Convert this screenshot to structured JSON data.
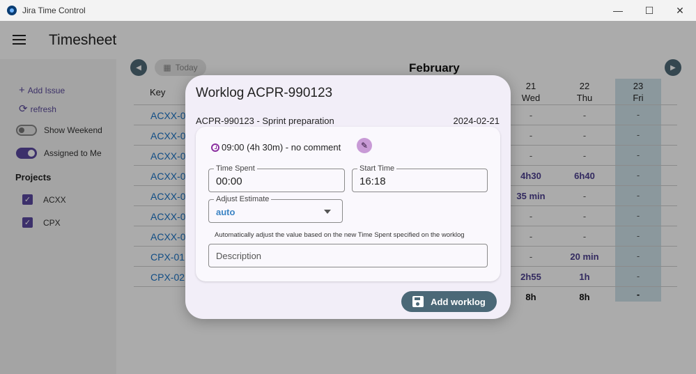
{
  "window": {
    "title": "Jira Time Control",
    "min": "—",
    "max": "☐",
    "close": "✕"
  },
  "appbar": {
    "title": "Timesheet"
  },
  "sidebar": {
    "add_issue": "Add Issue",
    "refresh": "refresh",
    "show_weekend": "Show Weekend",
    "assigned_to_me": "Assigned to Me",
    "projects_title": "Projects",
    "projects": [
      "ACXX",
      "CPX"
    ]
  },
  "main": {
    "today": "Today",
    "month": "February",
    "key_header": "Key",
    "days": [
      {
        "num": "21",
        "name": "Wed"
      },
      {
        "num": "22",
        "name": "Thu"
      },
      {
        "num": "23",
        "name": "Fri"
      }
    ],
    "rows": [
      {
        "key": "ACXX-0",
        "wed": "-",
        "thu": "-",
        "fri": "-"
      },
      {
        "key": "ACXX-0",
        "wed": "-",
        "thu": "-",
        "fri": "-"
      },
      {
        "key": "ACXX-0",
        "wed": "-",
        "thu": "-",
        "fri": "-"
      },
      {
        "key": "ACXX-0",
        "wed": "4h30",
        "thu": "6h40",
        "fri": "-"
      },
      {
        "key": "ACXX-0",
        "wed": "35 min",
        "thu": "-",
        "fri": "-"
      },
      {
        "key": "ACXX-0",
        "wed": "-",
        "thu": "-",
        "fri": "-"
      },
      {
        "key": "ACXX-0",
        "wed": "-",
        "thu": "-",
        "fri": "-"
      },
      {
        "key": "CPX-01",
        "wed": "-",
        "thu": "20 min",
        "fri": "-"
      },
      {
        "key": "CPX-02",
        "wed": "2h55",
        "thu": "1h",
        "fri": "-"
      }
    ],
    "totals": {
      "wed": "8h",
      "thu": "8h",
      "fri": "-"
    }
  },
  "dialog": {
    "title": "Worklog ACPR-990123",
    "issue_line": "ACPR-990123 - Sprint preparation",
    "date": "2024-02-21",
    "worklog_summary": "09:00 (4h 30m) - no comment",
    "time_spent_label": "Time Spent",
    "time_spent_value": "00:00",
    "start_time_label": "Start Time",
    "start_time_value": "16:18",
    "adjust_label": "Adjust Estimate",
    "adjust_value": "auto",
    "helper": "Automatically adjust the value based on the new Time Spent specified on the worklog",
    "description_placeholder": "Description",
    "add_button": "Add worklog"
  }
}
